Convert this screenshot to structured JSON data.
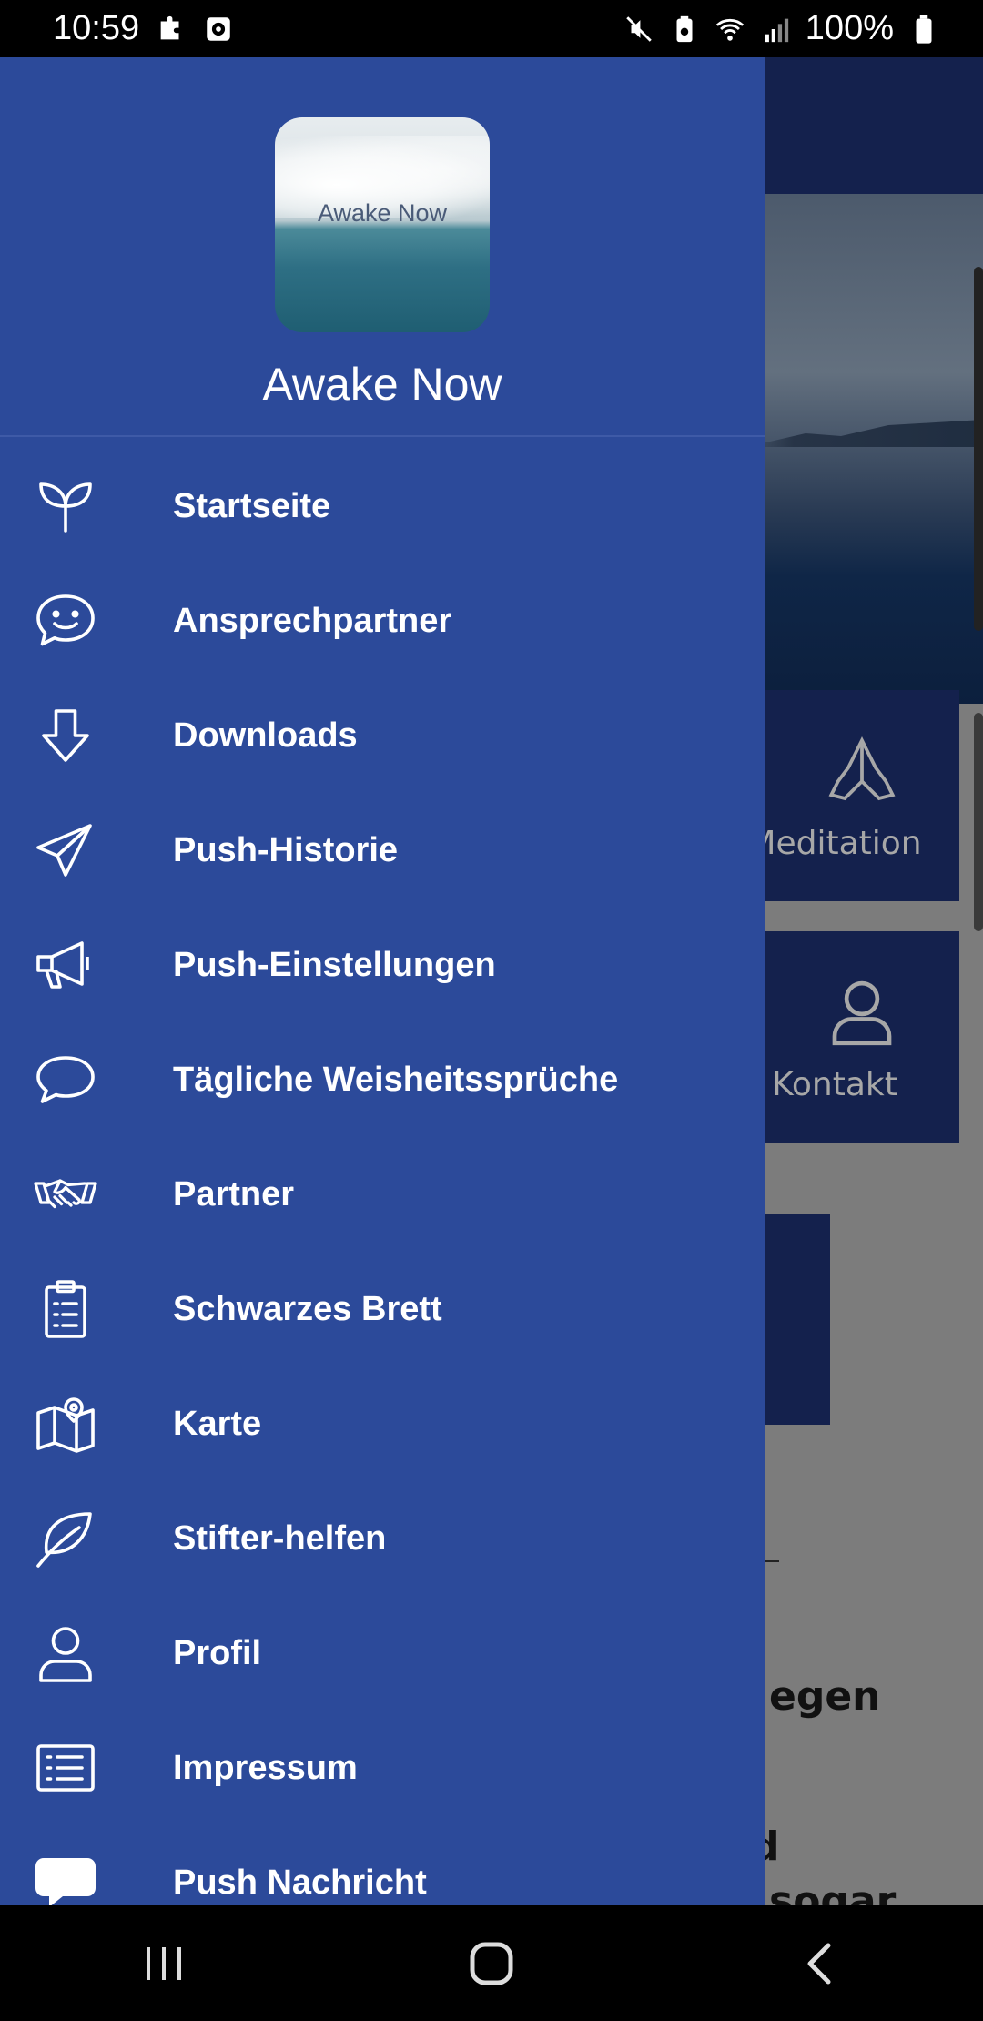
{
  "status_bar": {
    "time": "10:59",
    "battery": "100%"
  },
  "drawer": {
    "logo_text": "Awake Now",
    "app_name": "Awake Now",
    "menu": [
      {
        "label": "Startseite",
        "icon": "sprout-icon"
      },
      {
        "label": "Ansprechpartner",
        "icon": "smile-chat-icon"
      },
      {
        "label": "Downloads",
        "icon": "arrow-down-icon"
      },
      {
        "label": "Push-Historie",
        "icon": "paper-plane-icon"
      },
      {
        "label": "Push-Einstellungen",
        "icon": "megaphone-icon"
      },
      {
        "label": "Tägliche Weisheitssprüche",
        "icon": "speech-bubble-icon"
      },
      {
        "label": "Partner",
        "icon": "handshake-icon"
      },
      {
        "label": "Schwarzes Brett",
        "icon": "clipboard-icon"
      },
      {
        "label": "Karte",
        "icon": "map-icon"
      },
      {
        "label": "Stifter-helfen",
        "icon": "leaf-icon"
      },
      {
        "label": "Profil",
        "icon": "user-icon"
      },
      {
        "label": "Impressum",
        "icon": "list-icon"
      },
      {
        "label": "Push Nachricht",
        "icon": "message-icon"
      }
    ]
  },
  "background_app": {
    "tiles": [
      {
        "label": "Meditation",
        "icon": "praying-hands-icon"
      },
      {
        "label": "Kontakt",
        "icon": "user-icon"
      }
    ],
    "partial_text_1": "egen",
    "partial_text_2": "d",
    "partial_text_3": "sogar"
  },
  "colors": {
    "drawer_bg": "#2c4a9a",
    "app_dark": "#14214d"
  }
}
